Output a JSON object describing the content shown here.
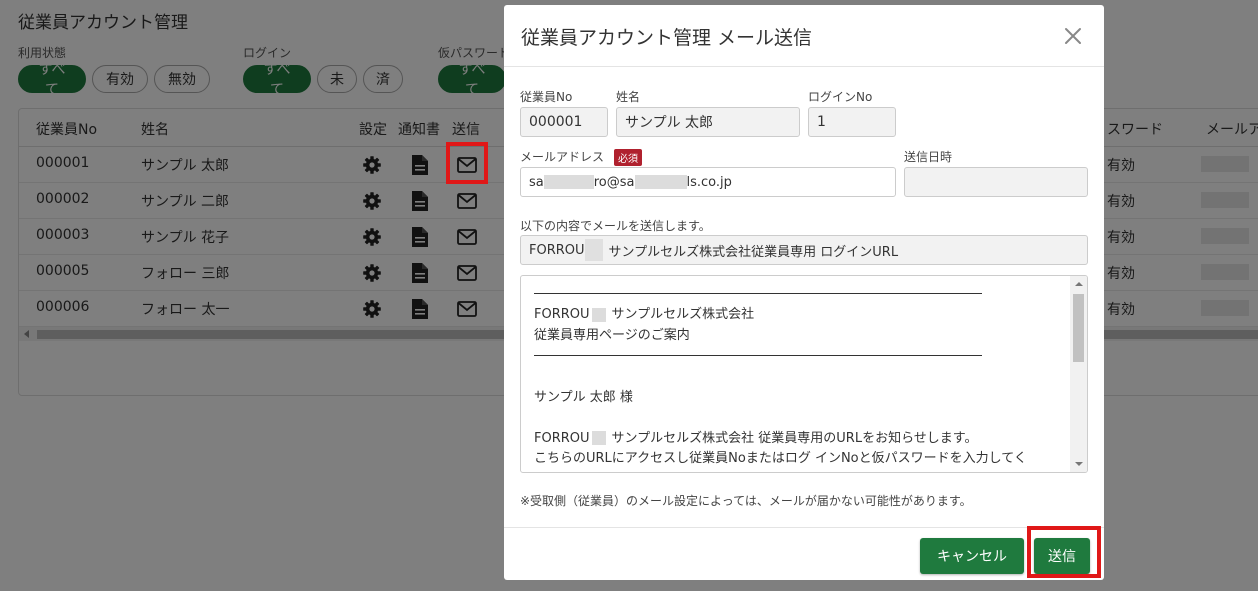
{
  "background": {
    "title": "従業員アカウント管理",
    "filters": [
      {
        "label": "利用状態",
        "options": [
          "すべて",
          "有効",
          "無効"
        ],
        "active": "すべて"
      },
      {
        "label": "ログイン",
        "options": [
          "すべて",
          "未",
          "済"
        ],
        "active": "すべて"
      },
      {
        "label": "仮パスワード",
        "options": [
          "すべて"
        ],
        "active": "すべて"
      }
    ],
    "table": {
      "headers": {
        "no": "従業員No",
        "name": "姓名",
        "settings": "設定",
        "notice": "通知書",
        "send": "送信",
        "password": "スワード",
        "mail": "メールア"
      },
      "rows": [
        {
          "no": "000001",
          "name": "サンプル 太郎",
          "password": "有効"
        },
        {
          "no": "000002",
          "name": "サンプル 二郎",
          "password": "有効"
        },
        {
          "no": "000003",
          "name": "サンプル 花子",
          "password": "有効"
        },
        {
          "no": "000005",
          "name": "フォロー 三郎",
          "password": "有効"
        },
        {
          "no": "000006",
          "name": "フォロー 太一",
          "password": "有効"
        }
      ]
    }
  },
  "modal": {
    "title": "従業員アカウント管理 メール送信",
    "fields": {
      "employee_no_label": "従業員No",
      "employee_no": "000001",
      "name_label": "姓名",
      "name": "サンプル 太郎",
      "login_no_label": "ログインNo",
      "login_no": "1",
      "email_label": "メールアドレス",
      "required_badge": "必須",
      "email_parts": [
        "sa",
        "ro@sa",
        "ls.co.jp"
      ],
      "sent_date_label": "送信日時",
      "sent_date": ""
    },
    "subject_label": "以下の内容でメールを送信します。",
    "subject_parts": [
      "FORROU",
      "サンプルセルズ株式会社従業員専用 ログインURL"
    ],
    "body": {
      "company_prefix": "FORROU",
      "company_suffix": "サンプルセルズ株式会社",
      "guide": "従業員専用ページのご案内",
      "greeting": "サンプル 太郎 様",
      "intro_suffix": "サンプルセルズ株式会社 従業員専用のURLをお知らせします。",
      "instruction": "こちらのURLにアクセスし従業員Noまたはログ インNoと仮パスワードを入力してく"
    },
    "note": "※受取側（従業員）のメール設定によっては、メールが届かない可能性があります。",
    "cancel_label": "キャンセル",
    "send_label": "送信"
  },
  "colors": {
    "accent": "#1f7a3e",
    "highlight": "#e01818",
    "required": "#b0212e"
  }
}
